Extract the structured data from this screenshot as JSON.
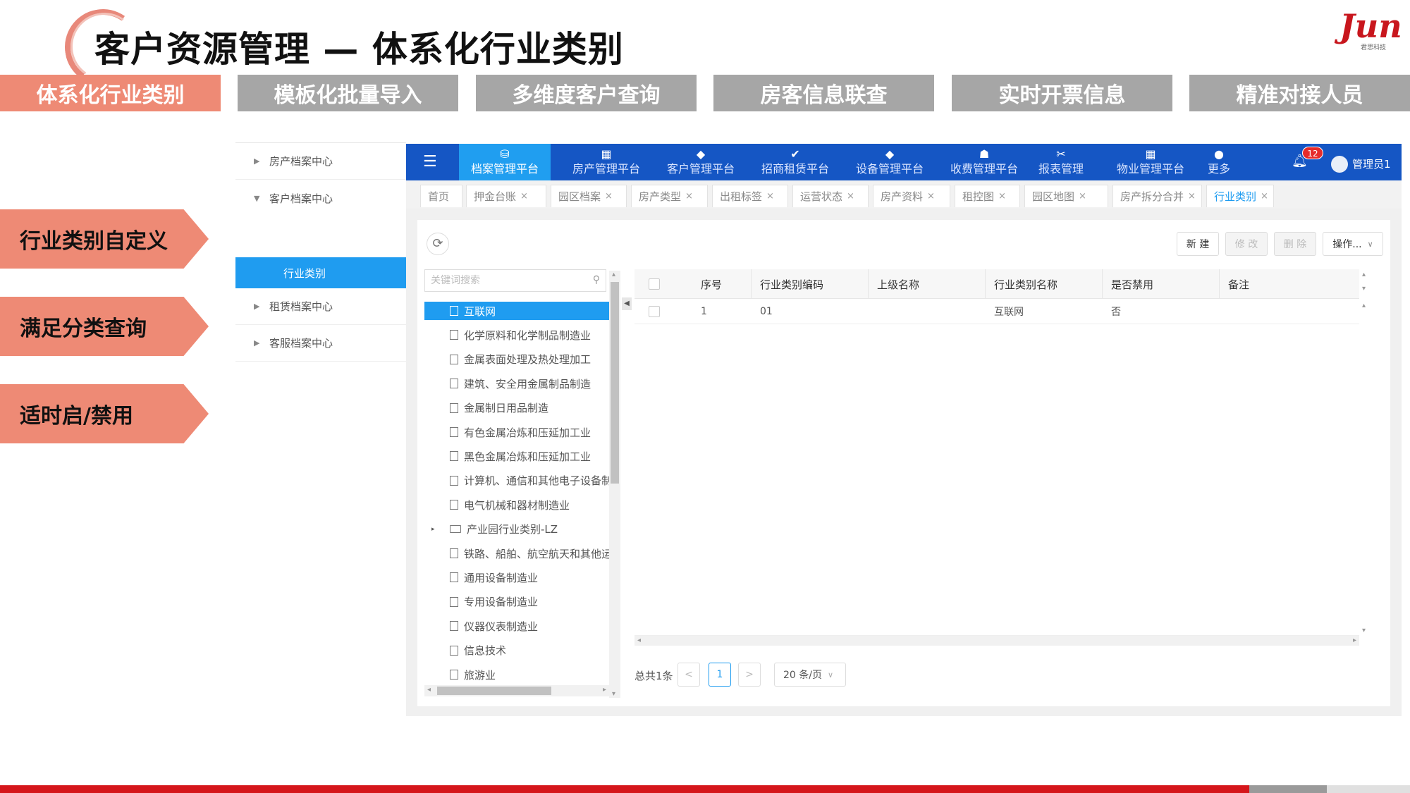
{
  "slide": {
    "title": "客户资源管理 — 体系化行业类别",
    "logo_text": "Jun",
    "logo_sub": "君思科技"
  },
  "feature_tabs": [
    "体系化行业类别",
    "模板化批量导入",
    "多维度客户查询",
    "房客信息联查",
    "实时开票信息",
    "精准对接人员"
  ],
  "side_points": [
    "行业类别自定义",
    "满足分类查询",
    "适时启/禁用"
  ],
  "sidebar": {
    "sections": [
      "房产档案中心",
      "客户档案中心",
      "租赁档案中心",
      "客服档案中心"
    ],
    "selected_item": "行业类别"
  },
  "topnav": {
    "items": [
      "档案管理平台",
      "房产管理平台",
      "客户管理平台",
      "招商租赁平台",
      "设备管理平台",
      "收费管理平台",
      "报表管理",
      "物业管理平台",
      "更多"
    ],
    "icons": [
      "archive-icon",
      "building-icon",
      "diamond-icon",
      "check-icon",
      "diamond-icon",
      "hand-coin-icon",
      "tools-icon",
      "building-icon",
      "more-icon"
    ],
    "active": "档案管理平台",
    "notification_count": "12",
    "user": "管理员1"
  },
  "page_tabs": [
    "首页",
    "押金台账",
    "园区档案",
    "房产类型",
    "出租标签",
    "运营状态",
    "房产资料",
    "租控图",
    "园区地图",
    "房产拆分合并",
    "行业类别"
  ],
  "active_tab": "行业类别",
  "toolbar": {
    "new_label": "新 建",
    "edit_label": "修 改",
    "delete_label": "删 除",
    "ops_label": "操作..."
  },
  "tree": {
    "search_placeholder": "关键词搜索",
    "items": [
      {
        "label": "互联网",
        "selected": true
      },
      {
        "label": "化学原料和化学制品制造业"
      },
      {
        "label": "金属表面处理及热处理加工"
      },
      {
        "label": "建筑、安全用金属制品制造"
      },
      {
        "label": "金属制日用品制造"
      },
      {
        "label": "有色金属冶炼和压延加工业"
      },
      {
        "label": "黑色金属冶炼和压延加工业"
      },
      {
        "label": "计算机、通信和其他电子设备制造业"
      },
      {
        "label": "电气机械和器材制造业"
      },
      {
        "label": "产业园行业类别-LZ",
        "folder": true
      },
      {
        "label": "铁路、船舶、航空航天和其他运输设备制造业"
      },
      {
        "label": "通用设备制造业"
      },
      {
        "label": "专用设备制造业"
      },
      {
        "label": "仪器仪表制造业"
      },
      {
        "label": "信息技术"
      },
      {
        "label": "旅游业"
      }
    ]
  },
  "grid": {
    "columns": [
      "序号",
      "行业类别编码",
      "上级名称",
      "行业类别名称",
      "是否禁用",
      "备注"
    ],
    "rows": [
      [
        "1",
        "01",
        "",
        "互联网",
        "否",
        ""
      ]
    ]
  },
  "pager": {
    "total": "总共1条",
    "prev": "<",
    "current": "1",
    "next": ">",
    "page_size": "20 条/页"
  },
  "colors": {
    "accent_orange": "#ee8a75",
    "nav_blue": "#1556c4",
    "active_blue": "#1f9cf0",
    "footer_red": "#d5161b"
  }
}
